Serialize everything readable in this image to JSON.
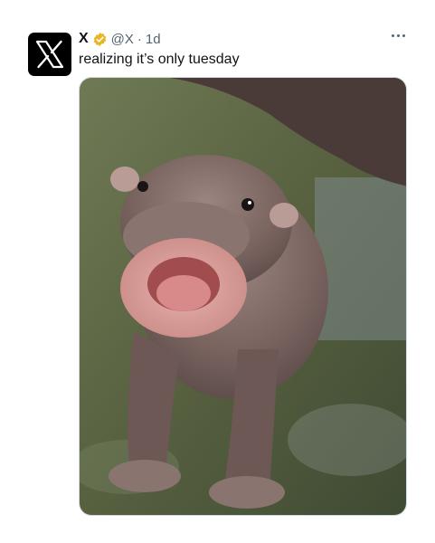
{
  "tweet": {
    "author_name": "X",
    "handle": "@X",
    "separator": "·",
    "time": "1d",
    "text": "realizing it’s only tuesday",
    "avatar_icon": "x-logo-icon",
    "verified_icon": "gold-verified-badge-icon",
    "more_icon": "more-options-icon",
    "media": {
      "subject": "baby pygmy hippo with mouth open",
      "colors": {
        "background_water": "#5c6b45",
        "hippo_skin": "#7a6460",
        "mouth": "#d69a96",
        "verified": "#e8b623"
      }
    }
  }
}
